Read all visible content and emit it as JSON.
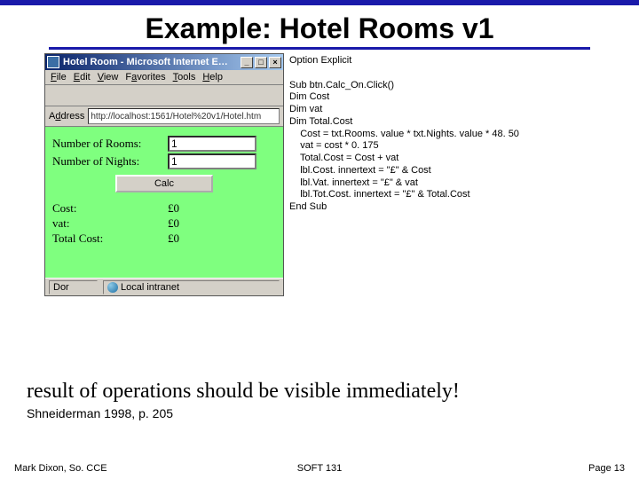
{
  "slide": {
    "title": "Example: Hotel Rooms v1",
    "conclusion": "result of operations should be visible immediately!",
    "citation": "Shneiderman 1998, p. 205"
  },
  "browser": {
    "window_title": "Hotel Room - Microsoft Internet E…",
    "menu": {
      "file": "File",
      "edit": "Edit",
      "view": "View",
      "favorites": "Favorites",
      "tools": "Tools",
      "help": "Help"
    },
    "address_label": "Address",
    "url": "http://localhost:1561/Hotel%20v1/Hotel.htm",
    "status_left": "Dor",
    "status_right": "Local intranet",
    "winbtns": {
      "min": "_",
      "max": "□",
      "close": "×"
    }
  },
  "form": {
    "rooms_label": "Number of Rooms:",
    "rooms_value": "1",
    "nights_label": "Number of Nights:",
    "nights_value": "1",
    "calc_label": "Calc",
    "cost_label": "Cost:",
    "cost_value": "£0",
    "vat_label": "vat:",
    "vat_value": "£0",
    "total_label": "Total Cost:",
    "total_value": "£0"
  },
  "code": {
    "l1": "Option Explicit",
    "l2": "",
    "l3": "Sub btn.Calc_On.Click()",
    "l4": "Dim Cost",
    "l5": "Dim vat",
    "l6": "Dim Total.Cost",
    "l7": "    Cost = txt.Rooms. value * txt.Nights. value * 48. 50",
    "l8": "    vat = cost * 0. 175",
    "l9": "    Total.Cost = Cost + vat",
    "l10": "    lbl.Cost. innertext = \"£\" & Cost",
    "l11": "    lbl.Vat. innertext = \"£\" & vat",
    "l12": "    lbl.Tot.Cost. innertext = \"£\" & Total.Cost",
    "l13": "End Sub"
  },
  "footer": {
    "left": "Mark Dixon, So. CCE",
    "center": "SOFT 131",
    "right": "Page 13"
  }
}
